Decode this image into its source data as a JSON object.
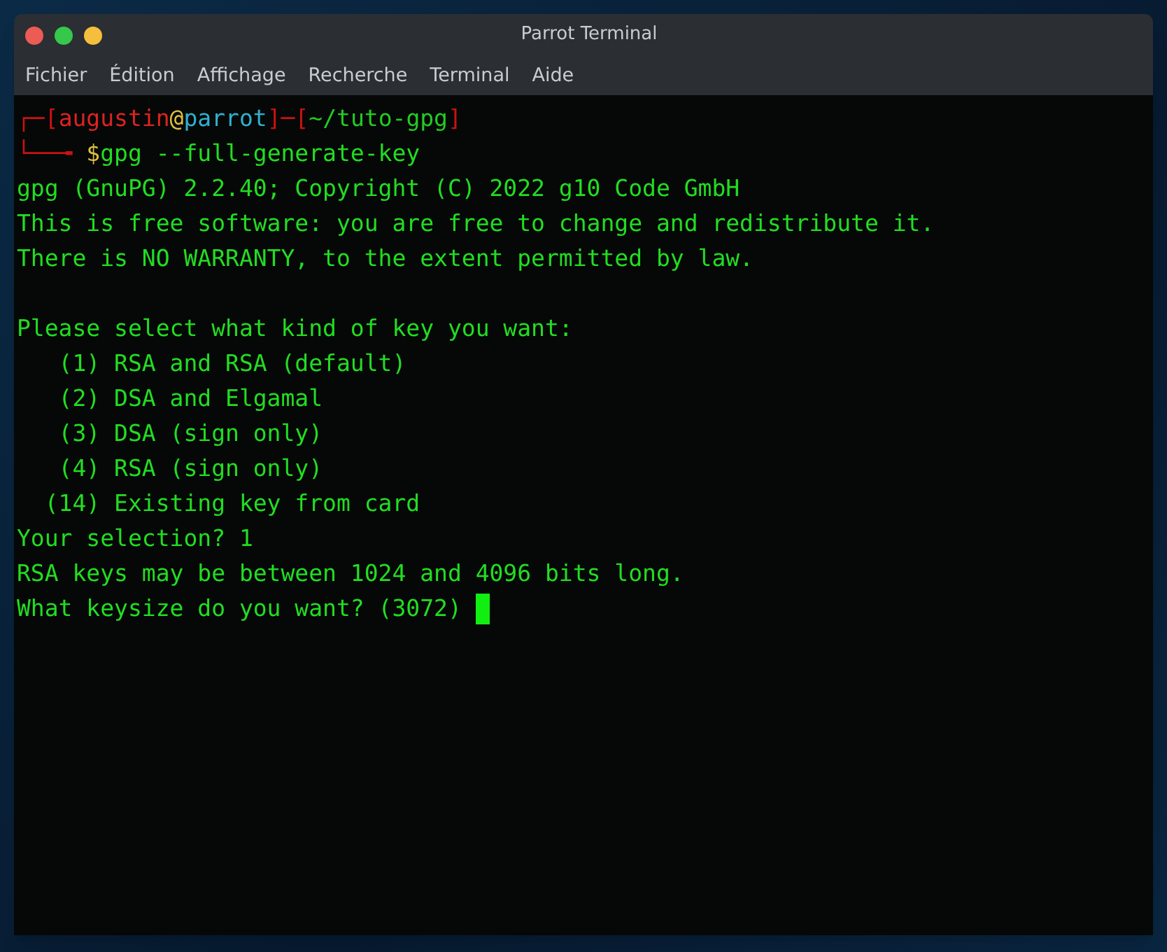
{
  "window": {
    "title": "Parrot Terminal"
  },
  "menu": [
    "Fichier",
    "Édition",
    "Affichage",
    "Recherche",
    "Terminal",
    "Aide"
  ],
  "prompt": [
    [
      {
        "text": "┌─[",
        "color": "#cc1111"
      },
      {
        "text": "augustin",
        "color": "#dd2222"
      },
      {
        "text": "@",
        "color": "#e0c040"
      },
      {
        "text": "parrot",
        "color": "#30b0d0"
      },
      {
        "text": "]─[",
        "color": "#cc1111"
      },
      {
        "text": "~/tuto-gpg",
        "color": "#22cc22"
      },
      {
        "text": "]",
        "color": "#cc1111"
      }
    ],
    [
      {
        "text": "└──╼ ",
        "color": "#cc1111"
      },
      {
        "text": "$",
        "color": "#e0c040"
      },
      {
        "text": "gpg --full-generate-key",
        "color": "#22dd22"
      }
    ]
  ],
  "output": [
    [
      "gpg (GnuPG) 2.2.40; Copyright (C) 2022 g10 Code GmbH",
      "This is free software: you are free to change and redistribute it.",
      "There is NO WARRANTY, to the extent permitted by law."
    ],
    [
      "Please select what kind of key you want:",
      "   (1) RSA and RSA (default)",
      "   (2) DSA and Elgamal",
      "   (3) DSA (sign only)",
      "   (4) RSA (sign only)",
      "  (14) Existing key from card",
      "Your selection? 1",
      "RSA keys may be between 1024 and 4096 bits long.",
      "What keysize do you want? (3072) "
    ]
  ]
}
